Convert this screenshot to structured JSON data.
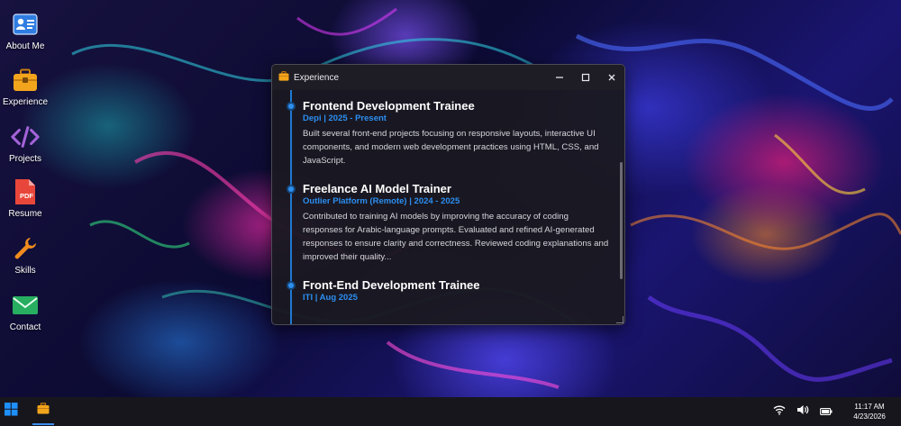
{
  "desktop": {
    "icons": [
      {
        "label": "About Me",
        "icon": "id-card-icon"
      },
      {
        "label": "Experience",
        "icon": "briefcase-icon"
      },
      {
        "label": "Projects",
        "icon": "code-icon"
      },
      {
        "label": "Resume",
        "icon": "pdf-file-icon"
      },
      {
        "label": "Skills",
        "icon": "wrench-icon"
      },
      {
        "label": "Contact",
        "icon": "envelope-icon"
      }
    ]
  },
  "window": {
    "title": "Experience",
    "icon": "briefcase-icon",
    "controls": {
      "minimize": "—",
      "maximize": "☐",
      "close": "✕"
    },
    "entries": [
      {
        "title": "Frontend Development Trainee",
        "meta": "Depi | 2025 - Present",
        "description": "Built several front-end projects focusing on responsive layouts, interactive UI components, and modern web development practices using HTML, CSS, and JavaScript."
      },
      {
        "title": "Freelance AI Model Trainer",
        "meta": "Outlier Platform (Remote) | 2024 - 2025",
        "description": "Contributed to training AI models by improving the accuracy of coding responses for Arabic-language prompts. Evaluated and refined AI-generated responses to ensure clarity and correctness. Reviewed coding explanations and improved their quality..."
      },
      {
        "title": "Front-End Development Trainee",
        "meta": "ITI | Aug 2025",
        "description": ""
      }
    ]
  },
  "taskbar": {
    "start_icon": "windows-start-icon",
    "pinned_app_icon": "briefcase-icon",
    "tray": {
      "wifi_icon": "wifi-icon",
      "volume_icon": "volume-icon",
      "battery_icon": "battery-icon"
    },
    "clock": {
      "time": "11:17 AM",
      "date": "4/23/2026"
    }
  },
  "colors": {
    "accent": "#2c8ef1",
    "window_bg": "#1a1921",
    "taskbar_bg": "#17161c",
    "briefcase": "#f2a51c",
    "code": "#a363d8",
    "pdf": "#e8463a",
    "wrench": "#f08c1e",
    "envelope": "#27ae60",
    "idcard": "#2f7de1"
  }
}
